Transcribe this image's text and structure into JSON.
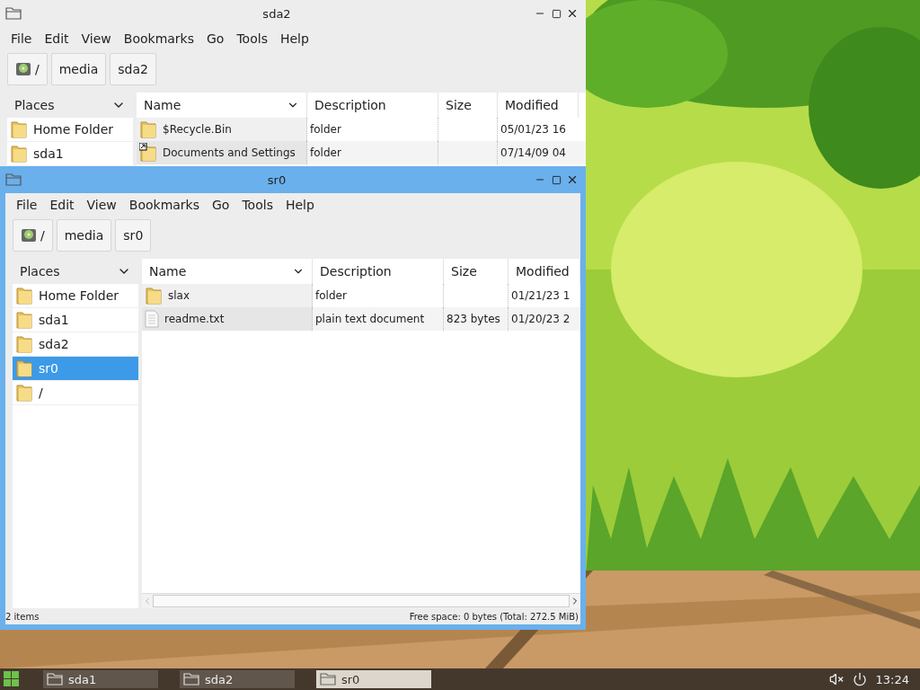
{
  "windows": [
    {
      "title": "sda2",
      "active": false,
      "menu": [
        "File",
        "Edit",
        "View",
        "Bookmarks",
        "Go",
        "Tools",
        "Help"
      ],
      "path": [
        {
          "label": "/",
          "kind": "root"
        },
        {
          "label": "media",
          "kind": "dir"
        },
        {
          "label": "sda2",
          "kind": "dir"
        }
      ],
      "places": {
        "title": "Places",
        "items": [
          {
            "label": "Home Folder",
            "selected": false
          },
          {
            "label": "sda1",
            "selected": false
          }
        ]
      },
      "columns": [
        "Name",
        "Description",
        "Size",
        "Modified"
      ],
      "rows": [
        {
          "name": "$Recycle.Bin",
          "kind": "folder",
          "link": false,
          "description": "folder",
          "size": "",
          "modified": "05/01/23 16"
        },
        {
          "name": "Documents and Settings",
          "kind": "folder",
          "link": true,
          "description": "folder",
          "size": "",
          "modified": "07/14/09 04"
        }
      ]
    },
    {
      "title": "sr0",
      "active": true,
      "menu": [
        "File",
        "Edit",
        "View",
        "Bookmarks",
        "Go",
        "Tools",
        "Help"
      ],
      "path": [
        {
          "label": "/",
          "kind": "root"
        },
        {
          "label": "media",
          "kind": "dir"
        },
        {
          "label": "sr0",
          "kind": "dir"
        }
      ],
      "places": {
        "title": "Places",
        "items": [
          {
            "label": "Home Folder",
            "selected": false
          },
          {
            "label": "sda1",
            "selected": false
          },
          {
            "label": "sda2",
            "selected": false
          },
          {
            "label": "sr0",
            "selected": true
          },
          {
            "label": "/",
            "selected": false
          }
        ]
      },
      "columns": [
        "Name",
        "Description",
        "Size",
        "Modified"
      ],
      "rows": [
        {
          "name": "slax",
          "kind": "folder",
          "link": false,
          "description": "folder",
          "size": "",
          "modified": "01/21/23 1"
        },
        {
          "name": "readme.txt",
          "kind": "text",
          "link": false,
          "description": "plain text document",
          "size": "823 bytes",
          "modified": "01/20/23 2"
        }
      ],
      "status": {
        "items": "2 items",
        "free": "Free space: 0 bytes (Total: 272.5 MiB)"
      }
    }
  ],
  "taskbar": {
    "items": [
      {
        "label": "sda1",
        "selected": false
      },
      {
        "label": "sda2",
        "selected": false
      },
      {
        "label": "sr0",
        "selected": true
      }
    ],
    "clock": "13:24"
  }
}
